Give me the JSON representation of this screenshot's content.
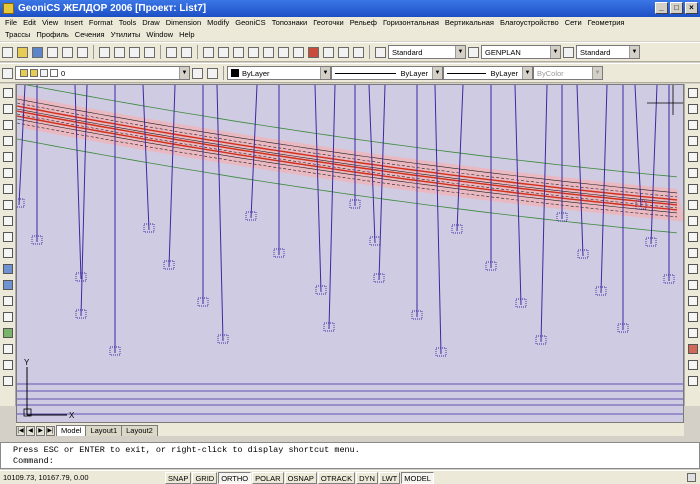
{
  "window": {
    "title": "GeoniCS ЖЕЛДОР 2006 [Проект: List7]",
    "controls": [
      "_",
      "□",
      "×"
    ]
  },
  "menu": {
    "row1": [
      "File",
      "Edit",
      "View",
      "Insert",
      "Format",
      "Tools",
      "Draw",
      "Dimension",
      "Modify",
      "GeoniCS",
      "Топознаки",
      "Геоточки",
      "Рельеф",
      "Горизонтальная",
      "Вертикальная",
      "Благоустройство",
      "Сети",
      "Геометрия"
    ],
    "row2": [
      "Трассы",
      "Профиль",
      "Сечения",
      "Утилиты",
      "Window",
      "Help"
    ]
  },
  "toolbar": {
    "text_style": "Standard",
    "dim_style": "GENPLAN",
    "table_style": "Standard"
  },
  "properties": {
    "layer": "0",
    "color": "ByLayer",
    "linetype": "ByLayer",
    "lineweight": "ByLayer",
    "plotstyle": "ByColor"
  },
  "layout_tabs": [
    "Model",
    "Layout1",
    "Layout2"
  ],
  "command": {
    "history": "Press ESC or ENTER to exit, or right-click to display shortcut menu.",
    "prompt": "Command:"
  },
  "status": {
    "coordinates": "10109.73, 10167.79, 0.00",
    "toggles": [
      "SNAP",
      "GRID",
      "ORTHO",
      "POLAR",
      "OSNAP",
      "OTRACK",
      "DYN",
      "LWT",
      "MODEL"
    ]
  },
  "ucs": {
    "x_label": "X",
    "y_label": "Y"
  },
  "colors": {
    "drawing_bg": "#cfcbe2",
    "survey_lines": "#3a2aa0",
    "rail_red": "#d0301c",
    "corridor_pink": "#f2b2b4",
    "title_blue": "#1d4fc4"
  }
}
